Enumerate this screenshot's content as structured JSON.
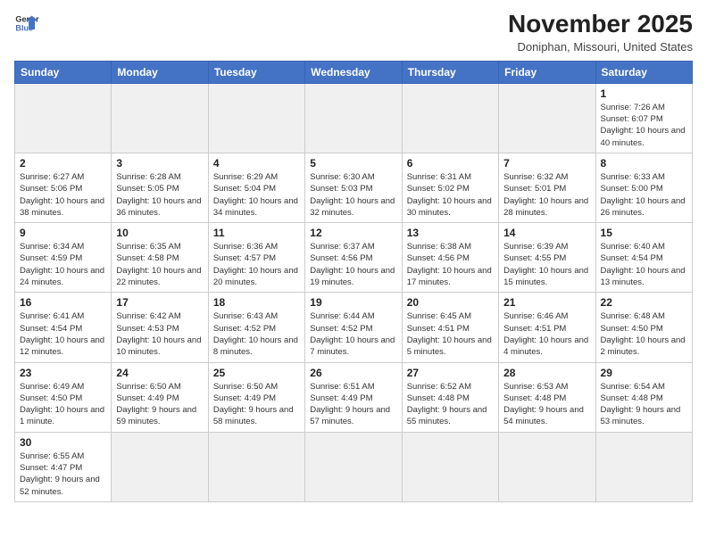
{
  "header": {
    "logo_line1": "General",
    "logo_line2": "Blue",
    "month": "November 2025",
    "location": "Doniphan, Missouri, United States"
  },
  "days_of_week": [
    "Sunday",
    "Monday",
    "Tuesday",
    "Wednesday",
    "Thursday",
    "Friday",
    "Saturday"
  ],
  "weeks": [
    [
      {
        "num": "",
        "info": ""
      },
      {
        "num": "",
        "info": ""
      },
      {
        "num": "",
        "info": ""
      },
      {
        "num": "",
        "info": ""
      },
      {
        "num": "",
        "info": ""
      },
      {
        "num": "",
        "info": ""
      },
      {
        "num": "1",
        "info": "Sunrise: 7:26 AM\nSunset: 6:07 PM\nDaylight: 10 hours and 40 minutes."
      }
    ],
    [
      {
        "num": "2",
        "info": "Sunrise: 6:27 AM\nSunset: 5:06 PM\nDaylight: 10 hours and 38 minutes."
      },
      {
        "num": "3",
        "info": "Sunrise: 6:28 AM\nSunset: 5:05 PM\nDaylight: 10 hours and 36 minutes."
      },
      {
        "num": "4",
        "info": "Sunrise: 6:29 AM\nSunset: 5:04 PM\nDaylight: 10 hours and 34 minutes."
      },
      {
        "num": "5",
        "info": "Sunrise: 6:30 AM\nSunset: 5:03 PM\nDaylight: 10 hours and 32 minutes."
      },
      {
        "num": "6",
        "info": "Sunrise: 6:31 AM\nSunset: 5:02 PM\nDaylight: 10 hours and 30 minutes."
      },
      {
        "num": "7",
        "info": "Sunrise: 6:32 AM\nSunset: 5:01 PM\nDaylight: 10 hours and 28 minutes."
      },
      {
        "num": "8",
        "info": "Sunrise: 6:33 AM\nSunset: 5:00 PM\nDaylight: 10 hours and 26 minutes."
      }
    ],
    [
      {
        "num": "9",
        "info": "Sunrise: 6:34 AM\nSunset: 4:59 PM\nDaylight: 10 hours and 24 minutes."
      },
      {
        "num": "10",
        "info": "Sunrise: 6:35 AM\nSunset: 4:58 PM\nDaylight: 10 hours and 22 minutes."
      },
      {
        "num": "11",
        "info": "Sunrise: 6:36 AM\nSunset: 4:57 PM\nDaylight: 10 hours and 20 minutes."
      },
      {
        "num": "12",
        "info": "Sunrise: 6:37 AM\nSunset: 4:56 PM\nDaylight: 10 hours and 19 minutes."
      },
      {
        "num": "13",
        "info": "Sunrise: 6:38 AM\nSunset: 4:56 PM\nDaylight: 10 hours and 17 minutes."
      },
      {
        "num": "14",
        "info": "Sunrise: 6:39 AM\nSunset: 4:55 PM\nDaylight: 10 hours and 15 minutes."
      },
      {
        "num": "15",
        "info": "Sunrise: 6:40 AM\nSunset: 4:54 PM\nDaylight: 10 hours and 13 minutes."
      }
    ],
    [
      {
        "num": "16",
        "info": "Sunrise: 6:41 AM\nSunset: 4:54 PM\nDaylight: 10 hours and 12 minutes."
      },
      {
        "num": "17",
        "info": "Sunrise: 6:42 AM\nSunset: 4:53 PM\nDaylight: 10 hours and 10 minutes."
      },
      {
        "num": "18",
        "info": "Sunrise: 6:43 AM\nSunset: 4:52 PM\nDaylight: 10 hours and 8 minutes."
      },
      {
        "num": "19",
        "info": "Sunrise: 6:44 AM\nSunset: 4:52 PM\nDaylight: 10 hours and 7 minutes."
      },
      {
        "num": "20",
        "info": "Sunrise: 6:45 AM\nSunset: 4:51 PM\nDaylight: 10 hours and 5 minutes."
      },
      {
        "num": "21",
        "info": "Sunrise: 6:46 AM\nSunset: 4:51 PM\nDaylight: 10 hours and 4 minutes."
      },
      {
        "num": "22",
        "info": "Sunrise: 6:48 AM\nSunset: 4:50 PM\nDaylight: 10 hours and 2 minutes."
      }
    ],
    [
      {
        "num": "23",
        "info": "Sunrise: 6:49 AM\nSunset: 4:50 PM\nDaylight: 10 hours and 1 minute."
      },
      {
        "num": "24",
        "info": "Sunrise: 6:50 AM\nSunset: 4:49 PM\nDaylight: 9 hours and 59 minutes."
      },
      {
        "num": "25",
        "info": "Sunrise: 6:50 AM\nSunset: 4:49 PM\nDaylight: 9 hours and 58 minutes."
      },
      {
        "num": "26",
        "info": "Sunrise: 6:51 AM\nSunset: 4:49 PM\nDaylight: 9 hours and 57 minutes."
      },
      {
        "num": "27",
        "info": "Sunrise: 6:52 AM\nSunset: 4:48 PM\nDaylight: 9 hours and 55 minutes."
      },
      {
        "num": "28",
        "info": "Sunrise: 6:53 AM\nSunset: 4:48 PM\nDaylight: 9 hours and 54 minutes."
      },
      {
        "num": "29",
        "info": "Sunrise: 6:54 AM\nSunset: 4:48 PM\nDaylight: 9 hours and 53 minutes."
      }
    ],
    [
      {
        "num": "30",
        "info": "Sunrise: 6:55 AM\nSunset: 4:47 PM\nDaylight: 9 hours and 52 minutes."
      },
      {
        "num": "",
        "info": ""
      },
      {
        "num": "",
        "info": ""
      },
      {
        "num": "",
        "info": ""
      },
      {
        "num": "",
        "info": ""
      },
      {
        "num": "",
        "info": ""
      },
      {
        "num": "",
        "info": ""
      }
    ]
  ]
}
